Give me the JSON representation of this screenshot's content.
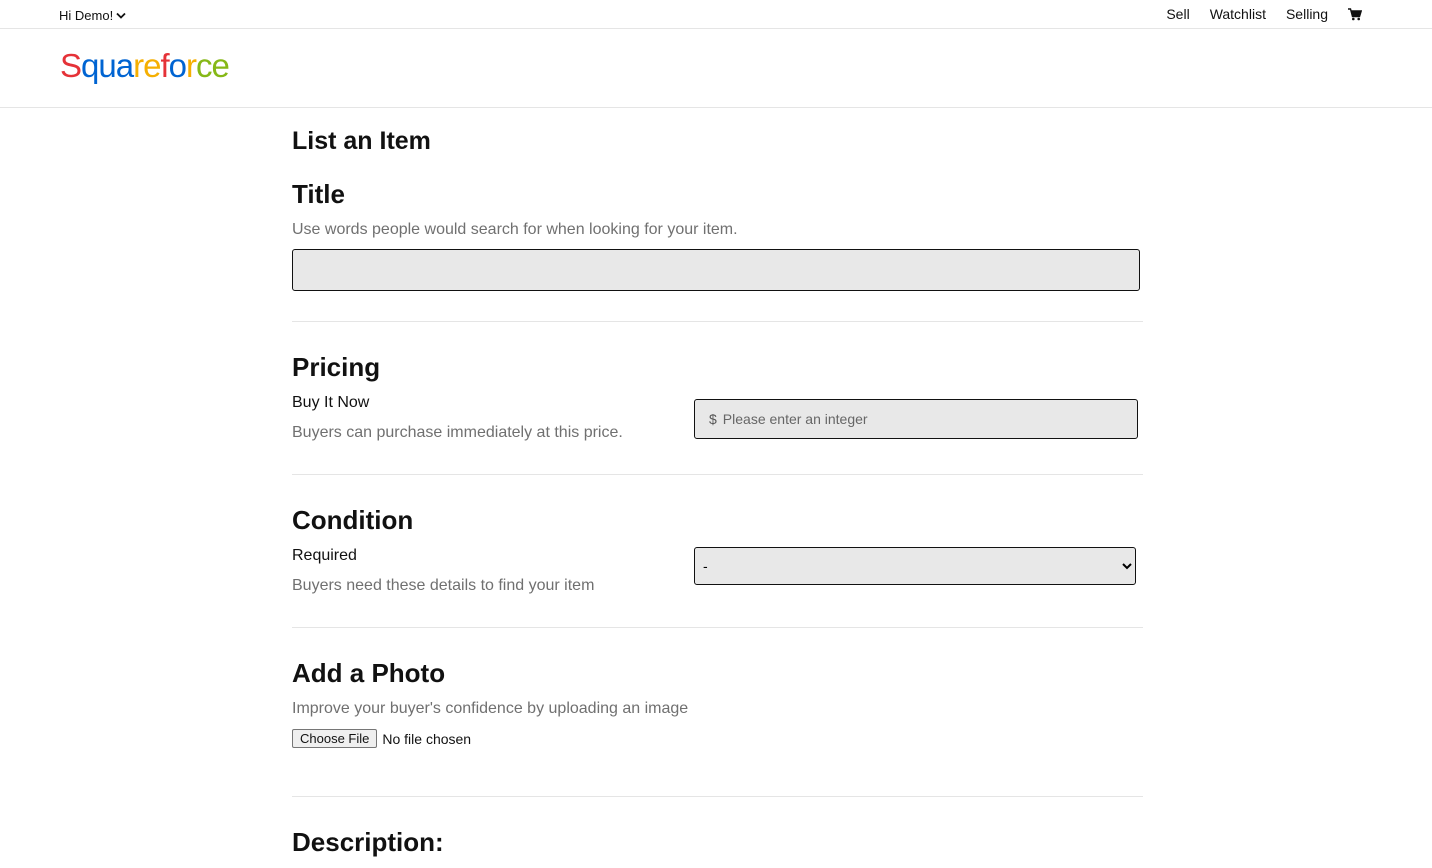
{
  "topbar": {
    "greeting": "Hi Demo!",
    "nav": {
      "sell": "Sell",
      "watchlist": "Watchlist",
      "selling": "Selling"
    }
  },
  "brand": {
    "letters": [
      {
        "char": "S",
        "color": "#e53238"
      },
      {
        "char": "q",
        "color": "#0064d2"
      },
      {
        "char": "u",
        "color": "#0064d2"
      },
      {
        "char": "a",
        "color": "#0064d2"
      },
      {
        "char": "r",
        "color": "#f5af02"
      },
      {
        "char": "e",
        "color": "#f5af02"
      },
      {
        "char": "f",
        "color": "#e53238"
      },
      {
        "char": "o",
        "color": "#0064d2"
      },
      {
        "char": "r",
        "color": "#f5af02"
      },
      {
        "char": "c",
        "color": "#86b817"
      },
      {
        "char": "e",
        "color": "#86b817"
      }
    ]
  },
  "page": {
    "title": "List an Item"
  },
  "title_section": {
    "heading": "Title",
    "help": "Use words people would search for when looking for your item.",
    "value": ""
  },
  "pricing": {
    "heading": "Pricing",
    "label": "Buy It Now",
    "help": "Buyers can purchase immediately at this price.",
    "currency": "$",
    "placeholder": "Please enter an integer"
  },
  "condition": {
    "heading": "Condition",
    "label": "Required",
    "help": "Buyers need these details to find your item",
    "selected": "-"
  },
  "photo": {
    "heading": "Add a Photo",
    "help": "Improve your buyer's confidence by uploading an image",
    "button": "Choose File",
    "status": "No file chosen"
  },
  "description": {
    "heading": "Description:"
  }
}
